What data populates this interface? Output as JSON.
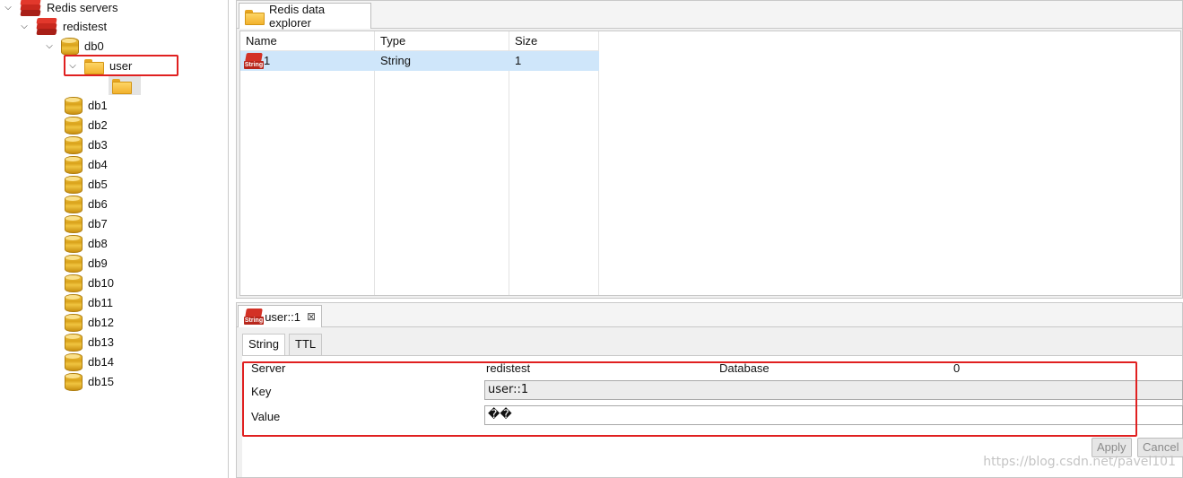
{
  "tree": {
    "root": {
      "label": "Redis servers"
    },
    "server": {
      "label": "redistest"
    },
    "db0": {
      "label": "db0"
    },
    "folder": {
      "label": "user"
    },
    "databases": [
      "db1",
      "db2",
      "db3",
      "db4",
      "db5",
      "db6",
      "db7",
      "db8",
      "db9",
      "db10",
      "db11",
      "db12",
      "db13",
      "db14",
      "db15"
    ]
  },
  "explorer": {
    "tab_label": "Redis data explorer",
    "columns": [
      "Name",
      "Type",
      "Size"
    ],
    "rows": [
      {
        "name": "1",
        "type": "String",
        "size": "1",
        "icon": "string-key-icon",
        "icon_text": "String"
      }
    ]
  },
  "editor": {
    "tab_label": "user::1",
    "tab_icon_text": "String",
    "close_glyph": "⊠",
    "subtabs": [
      "String",
      "TTL"
    ],
    "server_label": "Server",
    "server_value": "redistest",
    "database_label": "Database",
    "database_value": "0",
    "key_label": "Key",
    "key_value": "user::1",
    "value_label": "Value",
    "value_value": "��",
    "apply_label": "Apply",
    "cancel_label": "Cancel"
  },
  "watermark": "https://blog.csdn.net/pavel101",
  "colors": {
    "highlight": "#e02020",
    "selection": "#cfe6fa",
    "redis_red": "#c8281e"
  }
}
